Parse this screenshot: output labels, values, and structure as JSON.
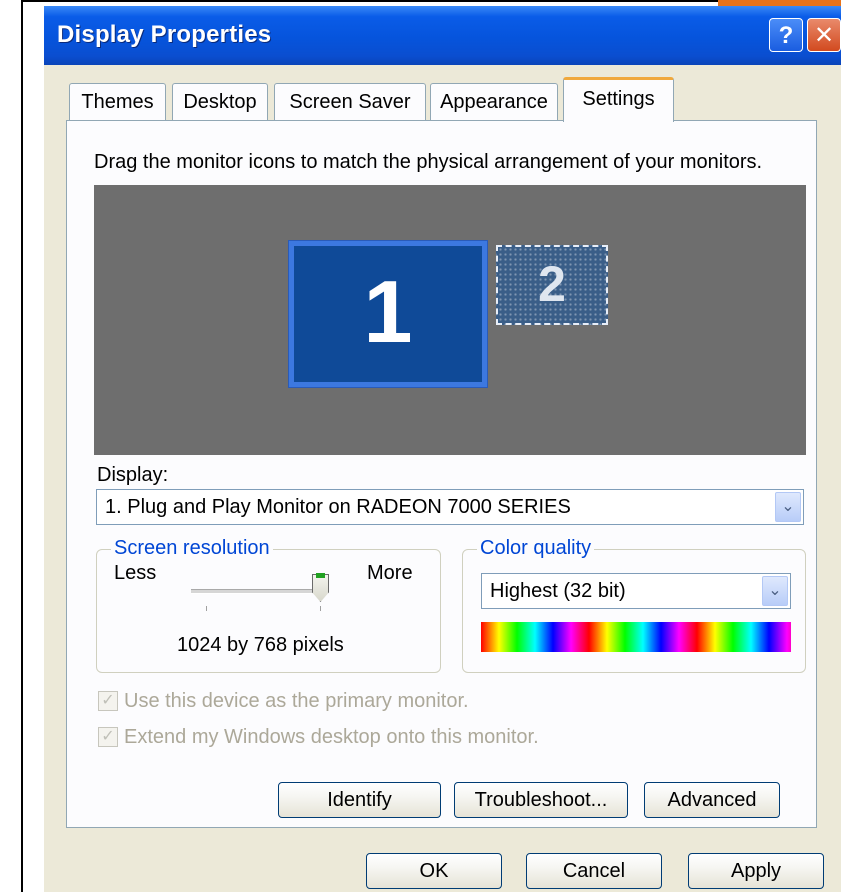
{
  "window": {
    "title": "Display Properties",
    "help_glyph": "?",
    "close_glyph": "✕"
  },
  "tabs": [
    {
      "label": "Themes"
    },
    {
      "label": "Desktop"
    },
    {
      "label": "Screen Saver"
    },
    {
      "label": "Appearance"
    },
    {
      "label": "Settings",
      "active": true
    }
  ],
  "settings": {
    "instruction": "Drag the monitor icons to match the physical arrangement of your monitors.",
    "monitors": [
      {
        "number": "1",
        "selected": true
      },
      {
        "number": "2",
        "selected": false
      }
    ],
    "display_label": "Display:",
    "display_value": "1. Plug and Play Monitor on RADEON 7000 SERIES",
    "dropdown_glyph": "⌄",
    "screen_resolution": {
      "title": "Screen resolution",
      "less_label": "Less",
      "more_label": "More",
      "value_text": "1024 by 768 pixels",
      "slider_fraction": 1.0
    },
    "color_quality": {
      "title": "Color quality",
      "value": "Highest (32 bit)"
    },
    "checkboxes": [
      {
        "label": "Use this device as the primary monitor.",
        "checked": true,
        "enabled": false
      },
      {
        "label": "Extend my Windows desktop onto this monitor.",
        "checked": true,
        "enabled": false
      }
    ],
    "check_glyph": "✓",
    "buttons": {
      "identify": "Identify",
      "troubleshoot": "Troubleshoot...",
      "advanced": "Advanced"
    }
  },
  "footer": {
    "ok": "OK",
    "cancel": "Cancel",
    "apply": "Apply"
  },
  "colors": {
    "titlebar": "#0654dc",
    "dialog_bg": "#ece9d8",
    "monitor_area": "#6e6e6e",
    "monitor_primary": "#0f4a98",
    "groupbox_title": "#0046d5",
    "active_tab_accent": "#f0a83c"
  }
}
